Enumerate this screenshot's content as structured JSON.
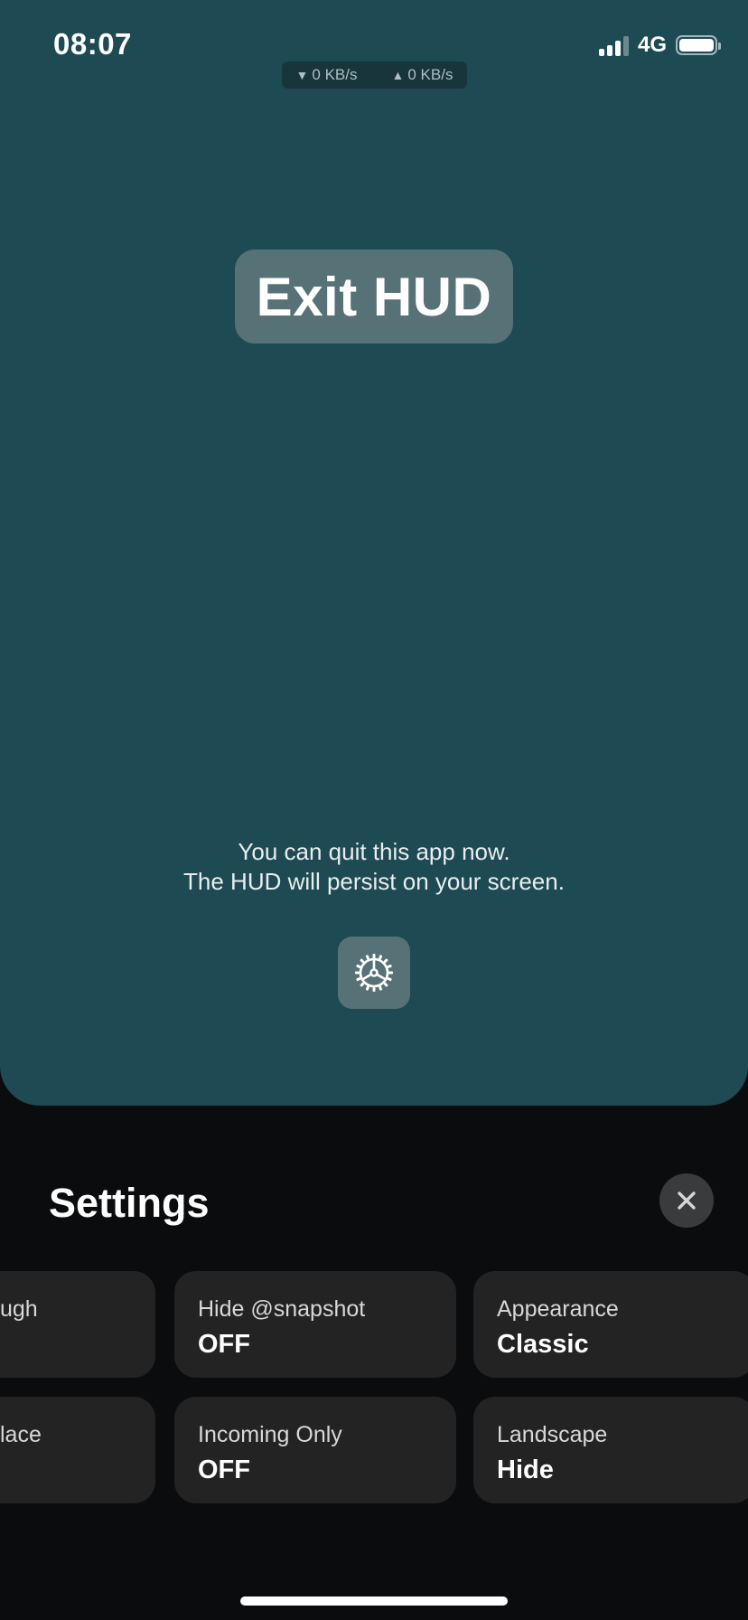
{
  "status_bar": {
    "time": "08:07",
    "network": "4G"
  },
  "speed_monitor": {
    "download": "0 KB/s",
    "upload": "0 KB/s"
  },
  "main": {
    "exit_button_label": "Exit HUD",
    "info_line_1": "You can quit this app now.",
    "info_line_2": "The HUD will persist on your screen.",
    "settings_icon": "gear-icon"
  },
  "settings": {
    "title": "Settings",
    "close_icon": "close-icon",
    "tiles": [
      {
        "label": "ugh",
        "value": ""
      },
      {
        "label": "Hide @snapshot",
        "value": "OFF"
      },
      {
        "label": "Appearance",
        "value": "Classic"
      },
      {
        "label": "lace",
        "value": ""
      },
      {
        "label": "Incoming Only",
        "value": "OFF"
      },
      {
        "label": "Landscape",
        "value": "Hide"
      }
    ]
  },
  "colors": {
    "app_background": "#1e4a53",
    "sheet_background": "#0b0c0d",
    "tile_background": "#232324",
    "button_background": "#577276"
  }
}
